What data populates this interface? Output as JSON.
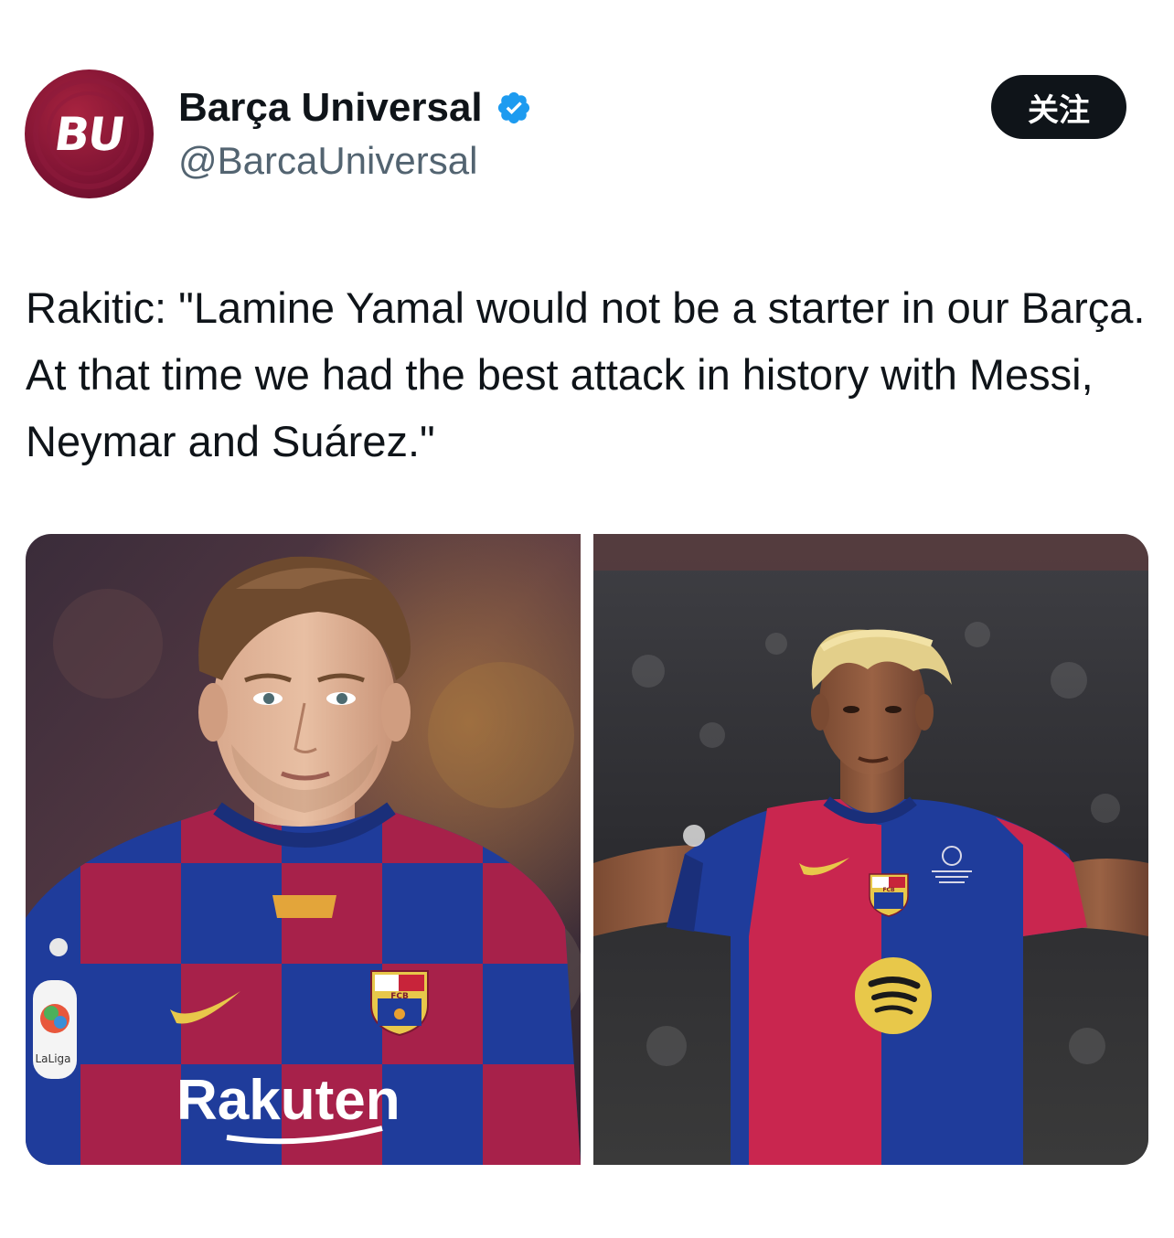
{
  "author": {
    "avatar_text": "BU",
    "display_name": "Barça Universal",
    "handle": "@BarcaUniversal",
    "verified": true,
    "avatar_color": "#7d1333",
    "verified_color": "#1d9bf0"
  },
  "actions": {
    "follow_label": "关注"
  },
  "tweet": {
    "text": "Rakitic: \"Lamine Yamal would not be a starter in our Barça. At that time we had the best attack in history with Messi, Neymar and Suárez.\""
  },
  "media": {
    "photo_left": {
      "sponsor_text": "Rakuten",
      "badge_text": "LaLiga",
      "crest_text": "FCB"
    },
    "photo_right": {
      "crest_text": "FCB"
    }
  },
  "colors": {
    "barca_blue": "#1f3c9b",
    "barca_red": "#a7214a",
    "text_primary": "#0f1419",
    "text_secondary": "#536471"
  }
}
